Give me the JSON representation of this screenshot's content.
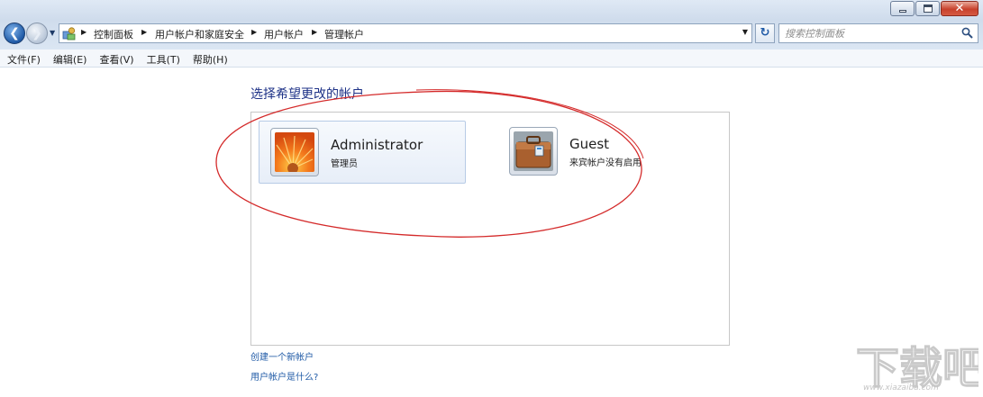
{
  "window": {
    "buttons": {
      "minimize": "–",
      "maximize": "□",
      "close": "✕"
    }
  },
  "nav": {
    "back_icon": "arrow-left-icon",
    "forward_icon": "arrow-right-icon",
    "back_glyph": "❮",
    "forward_glyph": "❯"
  },
  "address": {
    "breadcrumbs": [
      "控制面板",
      "用户帐户和家庭安全",
      "用户帐户",
      "管理帐户"
    ],
    "refresh_glyph": "↻"
  },
  "search": {
    "placeholder": "搜索控制面板"
  },
  "menu": [
    "文件(F)",
    "编辑(E)",
    "查看(V)",
    "工具(T)",
    "帮助(H)"
  ],
  "content": {
    "heading": "选择希望更改的帐户",
    "accounts": [
      {
        "name": "Administrator",
        "role": "管理员",
        "picture": "orange-flower",
        "selected": true
      },
      {
        "name": "Guest",
        "role": "来宾帐户没有启用",
        "picture": "briefcase",
        "selected": false
      }
    ],
    "links": [
      "创建一个新帐户",
      "用户帐户是什么?"
    ]
  },
  "annotation": {
    "shape": "red-ellipse",
    "color": "#d42a2a"
  },
  "watermark": {
    "text": "下载吧",
    "url_text": "www.xiazaiba.com"
  }
}
